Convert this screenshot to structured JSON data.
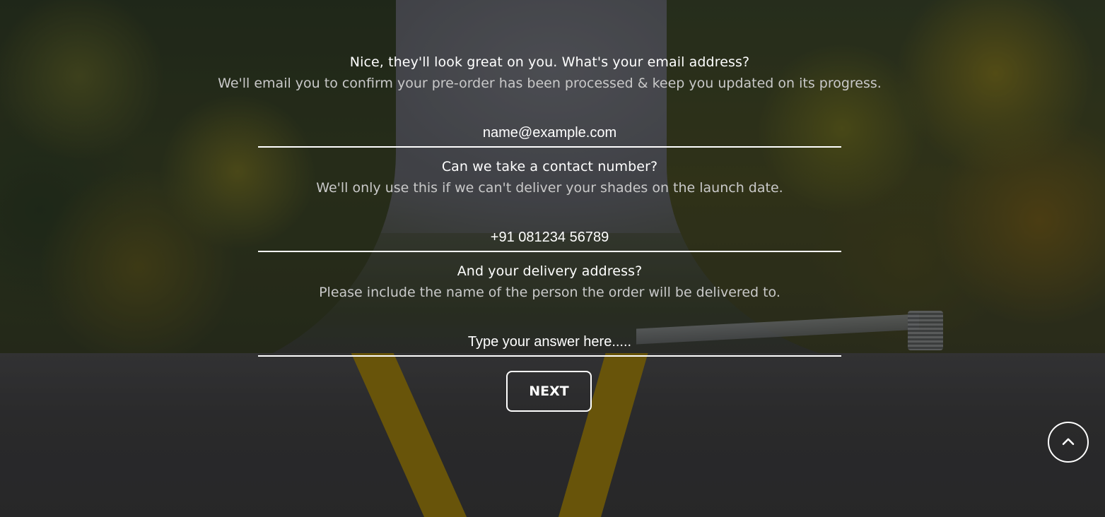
{
  "form": {
    "email": {
      "question": "Nice, they'll look great on you. What's your email address?",
      "hint": "We'll email you to confirm your pre-order has been processed & keep you updated on its progress.",
      "placeholder": "name@example.com"
    },
    "phone": {
      "question": "Can we take a contact number?",
      "hint": "We'll only use this if we can't deliver your shades on the launch date.",
      "placeholder": "+91 081234 56789"
    },
    "address": {
      "question": "And your delivery address?",
      "hint": "Please include the name of the person the order will be delivered to.",
      "placeholder": "Type your answer here....."
    },
    "next_label": "NEXT"
  },
  "scroll_top": {
    "icon": "chevron-up-icon"
  },
  "colors": {
    "text": "#ffffff",
    "hint_text": "#c9c9c9",
    "underline": "#ffffff"
  }
}
